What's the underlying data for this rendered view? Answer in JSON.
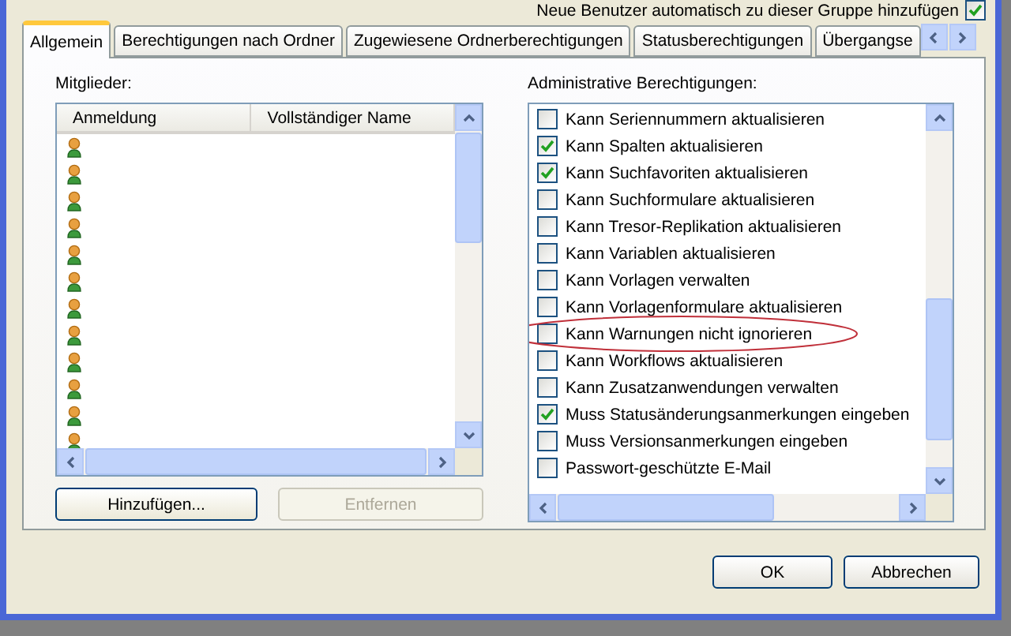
{
  "auto_add": {
    "label": "Neue Benutzer automatisch zu dieser Gruppe hinzufügen",
    "checked": true
  },
  "tabs": [
    {
      "label": "Allgemein",
      "selected": true
    },
    {
      "label": "Berechtigungen nach Ordner",
      "selected": false
    },
    {
      "label": "Zugewiesene Ordnerberechtigungen",
      "selected": false
    },
    {
      "label": "Statusberechtigungen",
      "selected": false
    },
    {
      "label": "Übergangse",
      "selected": false
    }
  ],
  "members": {
    "label": "Mitglieder:",
    "columns": [
      "Anmeldung",
      "Vollständiger Name"
    ],
    "rows": [
      {
        "kind": "user"
      },
      {
        "kind": "user"
      },
      {
        "kind": "user"
      },
      {
        "kind": "user"
      },
      {
        "kind": "user"
      },
      {
        "kind": "user"
      },
      {
        "kind": "user"
      },
      {
        "kind": "user"
      },
      {
        "kind": "user"
      },
      {
        "kind": "user"
      },
      {
        "kind": "user"
      },
      {
        "kind": "user"
      }
    ],
    "buttons": [
      {
        "label": "Hinzufügen...",
        "disabled": false
      },
      {
        "label": "Entfernen",
        "disabled": true
      }
    ]
  },
  "permissions": {
    "label": "Administrative Berechtigungen:",
    "items": [
      {
        "label": "Kann Seriennummern aktualisieren",
        "checked": false,
        "circled": false
      },
      {
        "label": "Kann Spalten aktualisieren",
        "checked": true,
        "circled": false
      },
      {
        "label": "Kann Suchfavoriten aktualisieren",
        "checked": true,
        "circled": false
      },
      {
        "label": "Kann Suchformulare aktualisieren",
        "checked": false,
        "circled": false
      },
      {
        "label": "Kann Tresor-Replikation aktualisieren",
        "checked": false,
        "circled": false
      },
      {
        "label": "Kann Variablen aktualisieren",
        "checked": false,
        "circled": false
      },
      {
        "label": "Kann Vorlagen verwalten",
        "checked": false,
        "circled": false
      },
      {
        "label": "Kann Vorlagenformulare aktualisieren",
        "checked": false,
        "circled": false
      },
      {
        "label": "Kann Warnungen nicht ignorieren",
        "checked": false,
        "circled": true
      },
      {
        "label": "Kann Workflows aktualisieren",
        "checked": false,
        "circled": false
      },
      {
        "label": "Kann Zusatzanwendungen verwalten",
        "checked": false,
        "circled": false
      },
      {
        "label": "Muss Statusänderungsanmerkungen eingeben",
        "checked": true,
        "circled": false
      },
      {
        "label": "Muss Versionsanmerkungen eingeben",
        "checked": false,
        "circled": false
      },
      {
        "label": "Passwort-geschützte E-Mail",
        "checked": false,
        "circled": false
      }
    ]
  },
  "buttons": [
    "OK",
    "Abbrechen"
  ]
}
